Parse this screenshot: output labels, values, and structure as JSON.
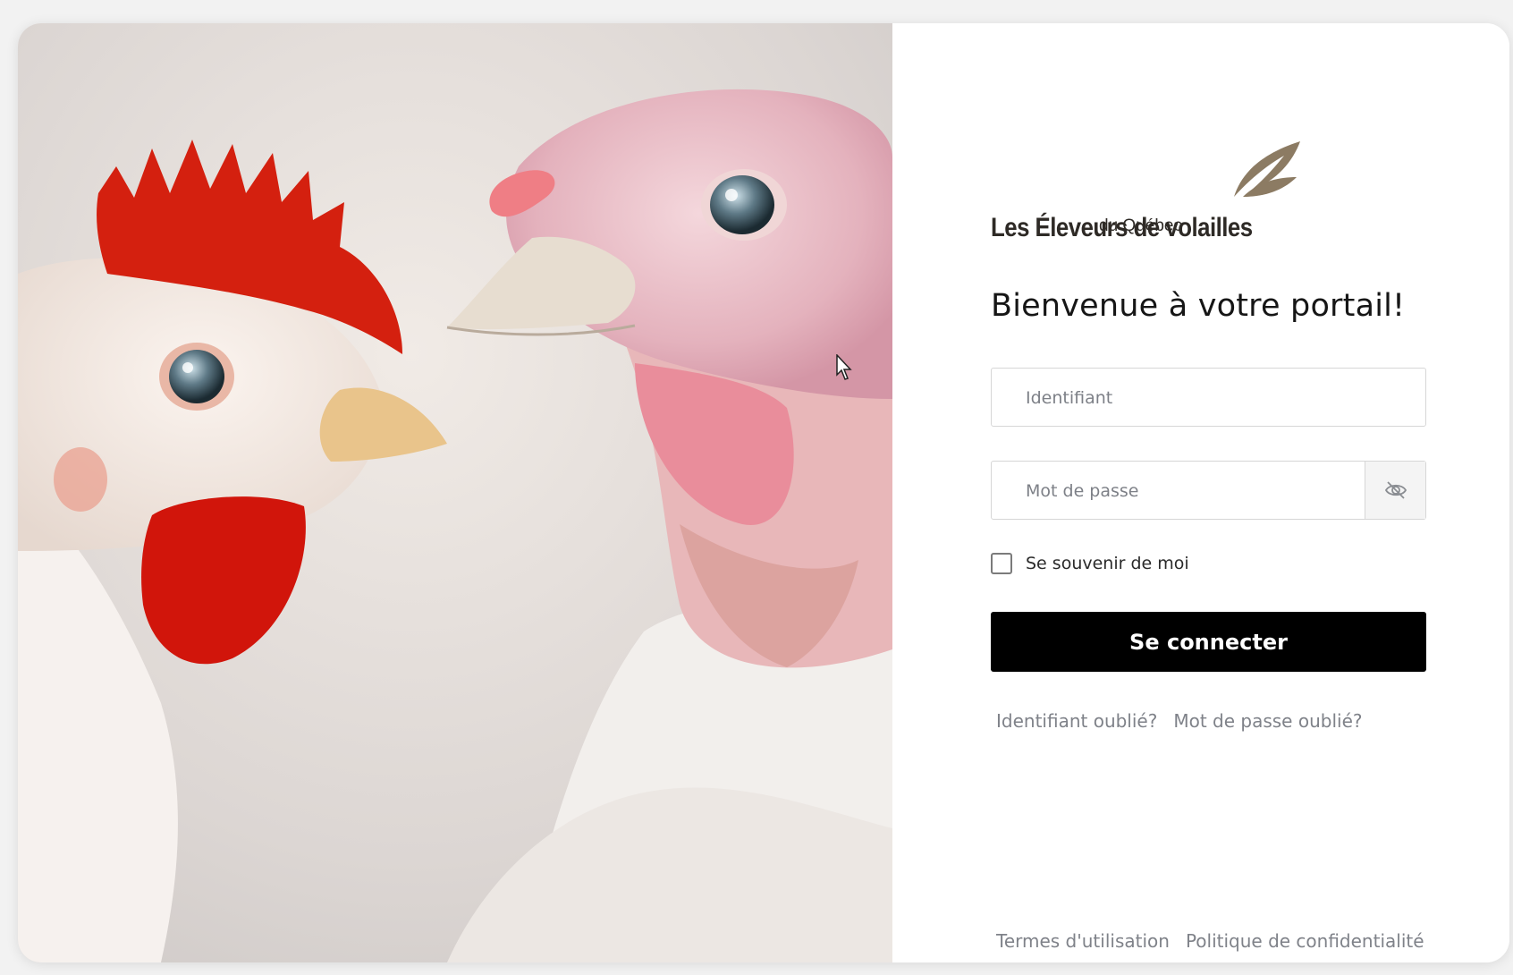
{
  "brand": {
    "name": "Les Éleveurs de volailles",
    "subtitle": "du Québec",
    "leaf_color": "#8c7b63"
  },
  "hero": {
    "image": "photo-of-hen-and-turkey",
    "description_icon": "poultry-photo"
  },
  "login": {
    "title": "Bienvenue à votre portail!",
    "username": {
      "placeholder": "Identifiant",
      "value": ""
    },
    "password": {
      "placeholder": "Mot de passe",
      "value": "",
      "toggle_icon": "eye-slash-icon"
    },
    "remember_label": "Se souvenir de moi",
    "remember_checked": false,
    "submit_label": "Se connecter",
    "forgot_username": "Identifiant oublié?",
    "forgot_password": "Mot de passe oublié?"
  },
  "footer": {
    "terms": "Termes d'utilisation",
    "privacy": "Politique de confidentialité"
  },
  "colors": {
    "button": "#000000",
    "link": "#7f8289",
    "comb": "#d21f10"
  }
}
